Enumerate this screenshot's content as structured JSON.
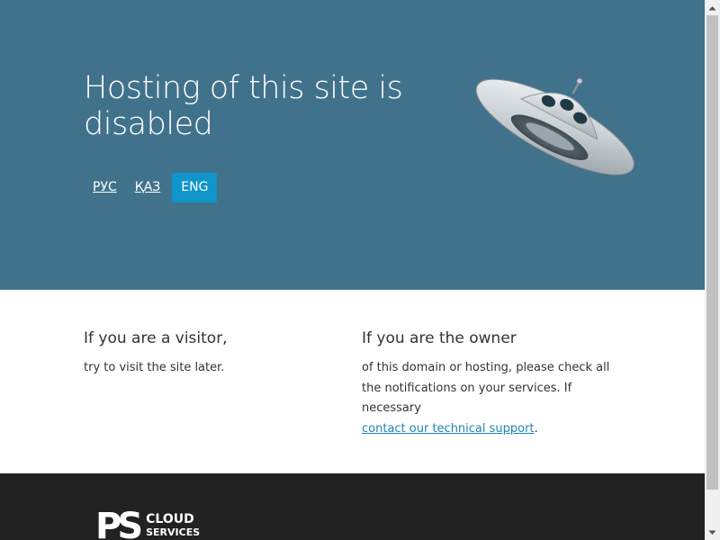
{
  "hero": {
    "title": "Hosting of this site is disabled",
    "languages": [
      {
        "label": "РУС",
        "active": false
      },
      {
        "label": "ҚАЗ",
        "active": false
      },
      {
        "label": "ENG",
        "active": true
      }
    ],
    "illustration": "ufo-illustration"
  },
  "visitor": {
    "heading": "If you are a visitor,",
    "text": "try to visit the site later."
  },
  "owner": {
    "heading": "If you are the owner",
    "text": "of this domain or hosting, please check all the notifications on your services. If necessary",
    "link_text": "contact our technical support",
    "suffix": "."
  },
  "footer": {
    "logo_mark": "PS",
    "logo_line1": "CLOUD",
    "logo_line2": "SERVICES"
  },
  "colors": {
    "hero_bg": "#41728c",
    "accent": "#0f95ca",
    "link": "#1f86b5",
    "footer_bg": "#222222"
  }
}
